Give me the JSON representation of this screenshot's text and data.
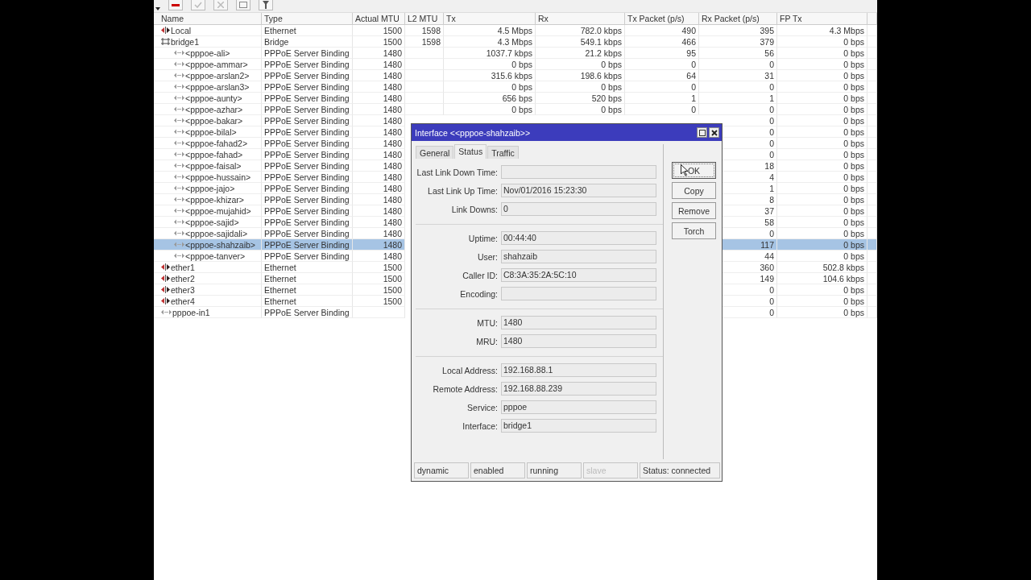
{
  "columns": [
    "Name",
    "Type",
    "Actual MTU",
    "L2 MTU",
    "Tx",
    "Rx",
    "Tx Packet (p/s)",
    "Rx Packet (p/s)",
    "FP Tx"
  ],
  "rows": [
    {
      "kind": "ethernet",
      "name": "Local",
      "type": "Ethernet",
      "mtu": "1500",
      "l2mtu": "1598",
      "tx": "4.5 Mbps",
      "rx": "782.0 kbps",
      "tx_pps": "490",
      "rx_pps": "395",
      "fp_tx": "4.3 Mbps",
      "selected": false
    },
    {
      "kind": "bridge",
      "name": "bridge1",
      "type": "Bridge",
      "mtu": "1500",
      "l2mtu": "1598",
      "tx": "4.3 Mbps",
      "rx": "549.1 kbps",
      "tx_pps": "466",
      "rx_pps": "379",
      "fp_tx": "0 bps",
      "selected": false,
      "children": [
        {
          "kind": "pppoe",
          "name": "<pppoe-ali>",
          "type": "PPPoE Server Binding",
          "mtu": "1480",
          "tx": "1037.7 kbps",
          "rx": "21.2 kbps",
          "tx_pps": "95",
          "rx_pps": "56",
          "fp_tx": "0 bps",
          "selected": false
        },
        {
          "kind": "pppoe",
          "name": "<pppoe-ammar>",
          "type": "PPPoE Server Binding",
          "mtu": "1480",
          "tx": "0 bps",
          "rx": "0 bps",
          "tx_pps": "0",
          "rx_pps": "0",
          "fp_tx": "0 bps",
          "selected": false
        },
        {
          "kind": "pppoe",
          "name": "<pppoe-arslan2>",
          "type": "PPPoE Server Binding",
          "mtu": "1480",
          "tx": "315.6 kbps",
          "rx": "198.6 kbps",
          "tx_pps": "64",
          "rx_pps": "31",
          "fp_tx": "0 bps",
          "selected": false
        },
        {
          "kind": "pppoe",
          "name": "<pppoe-arslan3>",
          "type": "PPPoE Server Binding",
          "mtu": "1480",
          "tx": "0 bps",
          "rx": "0 bps",
          "tx_pps": "0",
          "rx_pps": "0",
          "fp_tx": "0 bps",
          "selected": false
        },
        {
          "kind": "pppoe",
          "name": "<pppoe-aunty>",
          "type": "PPPoE Server Binding",
          "mtu": "1480",
          "tx": "656 bps",
          "rx": "520 bps",
          "tx_pps": "1",
          "rx_pps": "1",
          "fp_tx": "0 bps",
          "selected": false
        },
        {
          "kind": "pppoe",
          "name": "<pppoe-azhar>",
          "type": "PPPoE Server Binding",
          "mtu": "1480",
          "tx": "0 bps",
          "rx": "0 bps",
          "tx_pps": "0",
          "rx_pps": "0",
          "fp_tx": "0 bps",
          "selected": false
        },
        {
          "kind": "pppoe",
          "name": "<pppoe-bakar>",
          "type": "PPPoE Server Binding",
          "mtu": "1480",
          "rx_pps": "0",
          "fp_tx": "0 bps",
          "selected": false
        },
        {
          "kind": "pppoe",
          "name": "<pppoe-bilal>",
          "type": "PPPoE Server Binding",
          "mtu": "1480",
          "rx_pps": "0",
          "fp_tx": "0 bps",
          "selected": false
        },
        {
          "kind": "pppoe",
          "name": "<pppoe-fahad2>",
          "type": "PPPoE Server Binding",
          "mtu": "1480",
          "rx_pps": "0",
          "fp_tx": "0 bps",
          "selected": false
        },
        {
          "kind": "pppoe",
          "name": "<pppoe-fahad>",
          "type": "PPPoE Server Binding",
          "mtu": "1480",
          "rx_pps": "0",
          "fp_tx": "0 bps",
          "selected": false
        },
        {
          "kind": "pppoe",
          "name": "<pppoe-faisal>",
          "type": "PPPoE Server Binding",
          "mtu": "1480",
          "rx_pps": "18",
          "fp_tx": "0 bps",
          "selected": false
        },
        {
          "kind": "pppoe",
          "name": "<pppoe-hussain>",
          "type": "PPPoE Server Binding",
          "mtu": "1480",
          "rx_pps": "4",
          "fp_tx": "0 bps",
          "selected": false
        },
        {
          "kind": "pppoe",
          "name": "<pppoe-jajo>",
          "type": "PPPoE Server Binding",
          "mtu": "1480",
          "rx_pps": "1",
          "fp_tx": "0 bps",
          "selected": false
        },
        {
          "kind": "pppoe",
          "name": "<pppoe-khizar>",
          "type": "PPPoE Server Binding",
          "mtu": "1480",
          "rx_pps": "8",
          "fp_tx": "0 bps",
          "selected": false
        },
        {
          "kind": "pppoe",
          "name": "<pppoe-mujahid>",
          "type": "PPPoE Server Binding",
          "mtu": "1480",
          "rx_pps": "37",
          "fp_tx": "0 bps",
          "selected": false
        },
        {
          "kind": "pppoe",
          "name": "<pppoe-sajid>",
          "type": "PPPoE Server Binding",
          "mtu": "1480",
          "rx_pps": "58",
          "fp_tx": "0 bps",
          "selected": false
        },
        {
          "kind": "pppoe",
          "name": "<pppoe-sajidali>",
          "type": "PPPoE Server Binding",
          "mtu": "1480",
          "rx_pps": "0",
          "fp_tx": "0 bps",
          "selected": false
        },
        {
          "kind": "pppoe",
          "name": "<pppoe-shahzaib>",
          "type": "PPPoE Server Binding",
          "mtu": "1480",
          "rx_pps": "117",
          "fp_tx": "0 bps",
          "selected": true
        },
        {
          "kind": "pppoe",
          "name": "<pppoe-tanver>",
          "type": "PPPoE Server Binding",
          "mtu": "1480",
          "rx_pps": "44",
          "fp_tx": "0 bps",
          "selected": false
        }
      ]
    },
    {
      "kind": "ethernet",
      "name": "ether1",
      "type": "Ethernet",
      "mtu": "1500",
      "rx_pps": "360",
      "fp_tx": "502.8 kbps",
      "selected": false
    },
    {
      "kind": "ethernet",
      "name": "ether2",
      "type": "Ethernet",
      "mtu": "1500",
      "rx_pps": "149",
      "fp_tx": "104.6 kbps",
      "selected": false
    },
    {
      "kind": "ethernet",
      "name": "ether3",
      "type": "Ethernet",
      "mtu": "1500",
      "rx_pps": "0",
      "fp_tx": "0 bps",
      "selected": false
    },
    {
      "kind": "ethernet",
      "name": "ether4",
      "type": "Ethernet",
      "mtu": "1500",
      "rx_pps": "0",
      "fp_tx": "0 bps",
      "selected": false
    },
    {
      "kind": "pppoe",
      "name": "pppoe-in1",
      "type": "PPPoE Server Binding",
      "rx_pps": "0",
      "fp_tx": "0 bps",
      "selected": false
    }
  ],
  "dialog": {
    "title": "Interface <<pppoe-shahzaib>>",
    "tabs": [
      {
        "label": "General",
        "selected": false
      },
      {
        "label": "Status",
        "selected": true
      },
      {
        "label": "Traffic",
        "selected": false
      }
    ],
    "field_groups": [
      [
        {
          "label": "Last Link Down Time:"
        },
        {
          "label": "Last Link Up Time:",
          "value": "Nov/01/2016 15:23:30"
        },
        {
          "label": "Link Downs:",
          "value": "0"
        }
      ],
      [
        {
          "label": "Uptime:",
          "value": "00:44:40"
        },
        {
          "label": "User:",
          "value": "shahzaib"
        },
        {
          "label": "Caller ID:",
          "value": "C8:3A:35:2A:5C:10"
        },
        {
          "label": "Encoding:"
        }
      ],
      [
        {
          "label": "MTU:",
          "value": "1480"
        },
        {
          "label": "MRU:",
          "value": "1480"
        }
      ],
      [
        {
          "label": "Local Address:",
          "value": "192.168.88.1"
        },
        {
          "label": "Remote Address:",
          "value": "192.168.88.239"
        },
        {
          "label": "Service:",
          "value": "pppoe"
        },
        {
          "label": "Interface:",
          "value": "bridge1"
        }
      ]
    ],
    "buttons": [
      {
        "label": "OK",
        "focused": true
      },
      {
        "label": "Copy",
        "focused": false
      },
      {
        "label": "Remove",
        "focused": false
      },
      {
        "label": "Torch",
        "focused": false
      }
    ],
    "status_bar": [
      {
        "text": "dynamic",
        "disabled": false
      },
      {
        "text": "enabled",
        "disabled": false
      },
      {
        "text": "running",
        "disabled": false
      },
      {
        "text": "slave",
        "disabled": true
      },
      {
        "text": "Status: connected",
        "disabled": false
      }
    ]
  }
}
